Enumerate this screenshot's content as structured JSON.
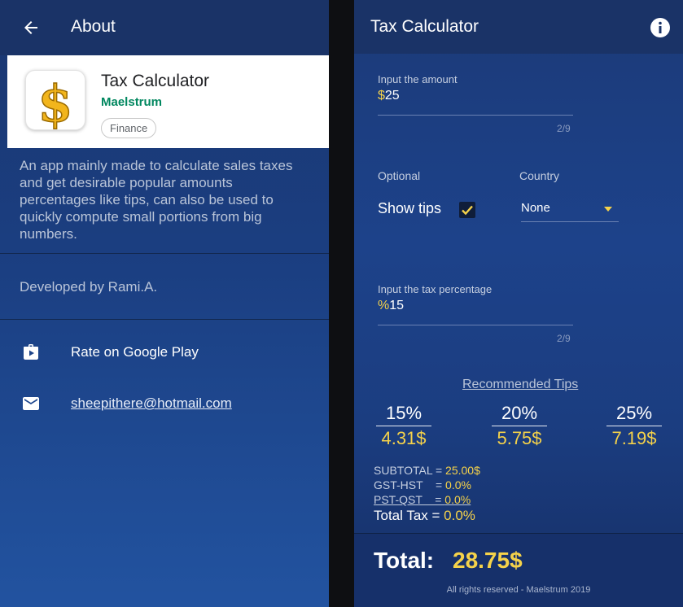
{
  "about": {
    "title": "About",
    "app": {
      "name": "Tax Calculator",
      "developer": "Maelstrum",
      "category": "Finance"
    },
    "description": "An app mainly made to calculate sales taxes and get desirable popular amounts percentages like tips, can also be used to quickly compute small portions from big numbers.",
    "developed_by": "Developed by Rami.A.",
    "rate_label": "Rate on Google Play",
    "email": "sheepithere@hotmail.com"
  },
  "calculator": {
    "title": "Tax Calculator",
    "amount": {
      "label": "Input the amount",
      "prefix": "$",
      "value": "25",
      "counter": "2/9"
    },
    "optional_label": "Optional",
    "show_tips_label": "Show tips",
    "show_tips_checked": true,
    "country": {
      "label": "Country",
      "value": "None"
    },
    "tax": {
      "label": "Input the tax percentage",
      "prefix": "%",
      "value": "15",
      "counter": "2/9"
    },
    "recommended_tips_label": "Recommended Tips",
    "tips": [
      {
        "percent": "15%",
        "amount": "4.31$"
      },
      {
        "percent": "20%",
        "amount": "5.75$"
      },
      {
        "percent": "25%",
        "amount": "7.19$"
      }
    ],
    "summary": {
      "subtotal_label": "SUBTOTAL = ",
      "subtotal_value": "25.00$",
      "gst_label": "GST-HST    = ",
      "gst_value": "0.0%",
      "pst_label": "PST-QST    = ",
      "pst_value": "0.0%",
      "total_tax_label": "Total Tax = ",
      "total_tax_value": "0.0%"
    },
    "total_label": "Total:",
    "total_value": "28.75$",
    "footer": "All rights reserved - Maelstrum 2019"
  },
  "colors": {
    "accent": "#f5d24a",
    "appbar": "#1a3367",
    "developer_green": "#01875f"
  }
}
